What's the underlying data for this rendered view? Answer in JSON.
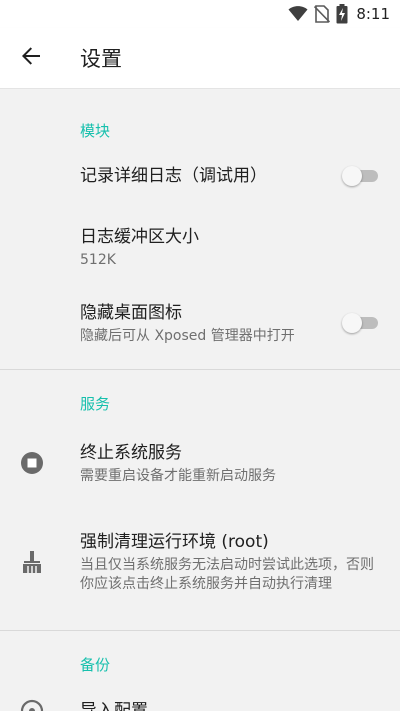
{
  "status_bar": {
    "time": "8:11",
    "icons": [
      "wifi-icon",
      "no-sim-icon",
      "battery-charging-icon"
    ]
  },
  "app_bar": {
    "back_icon": "arrow-back-icon",
    "title": "设置"
  },
  "sections": {
    "module": {
      "header": "模块",
      "verbose_log": {
        "title": "记录详细日志（调试用）",
        "enabled": false
      },
      "log_buffer": {
        "title": "日志缓冲区大小",
        "summary": "512K"
      },
      "hide_icon": {
        "title": "隐藏桌面图标",
        "summary": "隐藏后可从 Xposed 管理器中打开",
        "enabled": false
      }
    },
    "service": {
      "header": "服务",
      "stop_service": {
        "icon": "stop-circle-icon",
        "title": "终止系统服务",
        "summary": "需要重启设备才能重新启动服务"
      },
      "force_clean": {
        "icon": "broom-icon",
        "title": "强制清理运行环境 (root)",
        "summary": "当且仅当系统服务无法启动时尝试此选项，否则你应该点击终止系统服务并自动执行清理"
      }
    },
    "backup": {
      "header": "备份",
      "import_config": {
        "icon": "import-icon",
        "title": "导入配置"
      }
    }
  },
  "colors": {
    "accent": "#17c0ad",
    "background": "#f2f2f2",
    "switch_off_track": "#bdbdbd"
  }
}
